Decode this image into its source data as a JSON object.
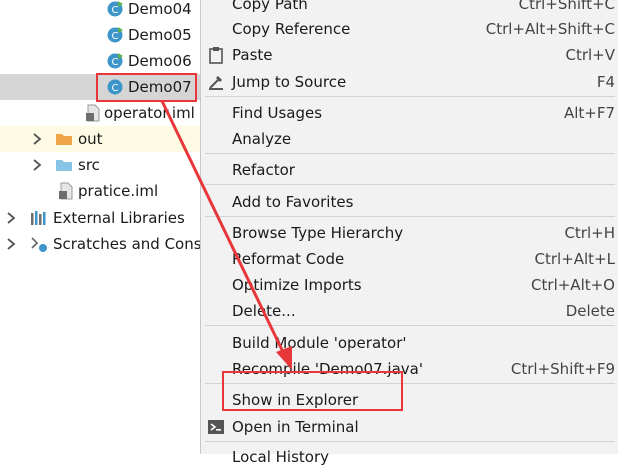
{
  "tree": {
    "items": [
      {
        "label": "Demo04",
        "icon": "java-class-icon"
      },
      {
        "label": "Demo05",
        "icon": "java-class-icon"
      },
      {
        "label": "Demo06",
        "icon": "java-class-icon"
      },
      {
        "label": "Demo07",
        "icon": "java-class-icon"
      },
      {
        "label": "operator.iml",
        "icon": "iml-file-icon"
      },
      {
        "label": "out",
        "icon": "folder-icon"
      },
      {
        "label": "src",
        "icon": "folder-icon"
      },
      {
        "label": "pratice.iml",
        "icon": "iml-file-icon"
      },
      {
        "label": "External Libraries",
        "icon": "library-icon"
      },
      {
        "label": "Scratches and Conso",
        "icon": "scratches-icon"
      }
    ]
  },
  "menu": {
    "items": [
      {
        "label": "Copy Path",
        "shortcut": "Ctrl+Shift+C"
      },
      {
        "label": "Copy Reference",
        "shortcut": "Ctrl+Alt+Shift+C"
      },
      {
        "label": "Paste",
        "shortcut": "Ctrl+V",
        "icon": "paste-icon"
      },
      {
        "label": "Jump to Source",
        "shortcut": "F4",
        "icon": "jump-to-source-icon"
      },
      {
        "label": "Find Usages",
        "shortcut": "Alt+F7"
      },
      {
        "label": "Analyze",
        "shortcut": ""
      },
      {
        "label": "Refactor",
        "shortcut": ""
      },
      {
        "label": "Add to Favorites",
        "shortcut": ""
      },
      {
        "label": "Browse Type Hierarchy",
        "shortcut": "Ctrl+H"
      },
      {
        "label": "Reformat Code",
        "shortcut": "Ctrl+Alt+L"
      },
      {
        "label": "Optimize Imports",
        "shortcut": "Ctrl+Alt+O"
      },
      {
        "label": "Delete...",
        "shortcut": "Delete"
      },
      {
        "label": "Build Module 'operator'",
        "shortcut": ""
      },
      {
        "label": "Recompile 'Demo07.java'",
        "shortcut": "Ctrl+Shift+F9"
      },
      {
        "label": "Show in Explorer",
        "shortcut": ""
      },
      {
        "label": "Open in Terminal",
        "shortcut": "",
        "icon": "terminal-icon"
      },
      {
        "label": "Local History",
        "shortcut": ""
      }
    ]
  },
  "colors": {
    "annotation": "#e8373b",
    "selection": "#d5d5d5",
    "menu_bg": "#f2f2f2",
    "class_icon": "#3d95c9"
  }
}
